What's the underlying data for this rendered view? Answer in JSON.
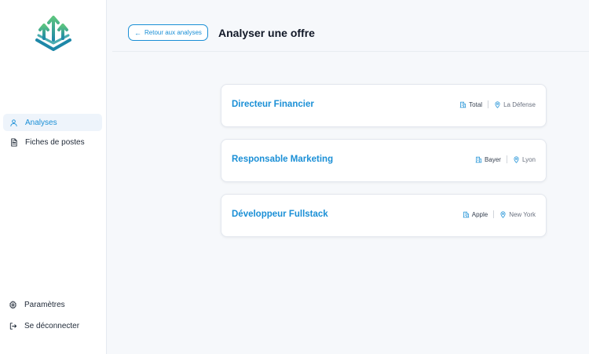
{
  "sidebar": {
    "nav": [
      {
        "label": "Analyses",
        "icon": "user-icon",
        "active": true
      },
      {
        "label": "Fiches de postes",
        "icon": "document-icon",
        "active": false
      }
    ],
    "bottom": [
      {
        "label": "Paramètres",
        "icon": "gear-icon"
      },
      {
        "label": "Se déconnecter",
        "icon": "logout-icon"
      }
    ]
  },
  "header": {
    "back_label": "Retour aux analyses",
    "title": "Analyser une offre"
  },
  "offers": [
    {
      "title": "Directeur Financier",
      "company": "Total",
      "location": "La Défense"
    },
    {
      "title": "Responsable Marketing",
      "company": "Bayer",
      "location": "Lyon"
    },
    {
      "title": "Développeur Fullstack",
      "company": "Apple",
      "location": "New York"
    }
  ],
  "colors": {
    "accent": "#1a8fd6",
    "active_bg": "#eef4fb",
    "background": "#f6f8fb",
    "logo_green": "#4cb87a",
    "logo_teal": "#1e88a8"
  }
}
